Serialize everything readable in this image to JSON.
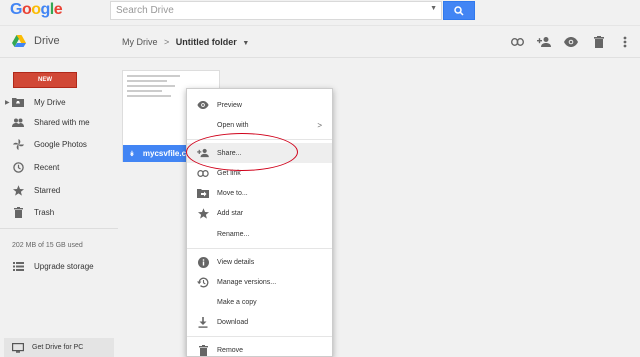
{
  "logo": {
    "letters": [
      "G",
      "o",
      "o",
      "g",
      "l",
      "e"
    ],
    "colors": [
      "#4285f4",
      "#ea4335",
      "#fbbc05",
      "#4285f4",
      "#34a853",
      "#ea4335"
    ]
  },
  "search": {
    "placeholder": "Search Drive"
  },
  "app": {
    "title": "Drive"
  },
  "breadcrumb": {
    "root": "My Drive",
    "separator": ">",
    "current": "Untitled folder"
  },
  "sidebar": {
    "new_label": "NEW",
    "items": [
      {
        "label": "My Drive",
        "icon": "my-drive-icon"
      },
      {
        "label": "Shared with me",
        "icon": "people-icon"
      },
      {
        "label": "Google Photos",
        "icon": "photos-pinwheel-icon"
      },
      {
        "label": "Recent",
        "icon": "clock-icon"
      },
      {
        "label": "Starred",
        "icon": "star-icon"
      },
      {
        "label": "Trash",
        "icon": "trash-icon"
      }
    ],
    "quota": "202 MB of 15 GB used",
    "upgrade": "Upgrade storage",
    "get_drive": "Get Drive for PC"
  },
  "file": {
    "name": "mycsvfile.c"
  },
  "menu": {
    "items": [
      {
        "label": "Preview",
        "icon": "eye-icon"
      },
      {
        "label": "Open with",
        "icon": "",
        "submenu": ">"
      },
      {
        "label": "Share...",
        "icon": "person-add-icon"
      },
      {
        "label": "Get link",
        "icon": "link-icon"
      },
      {
        "label": "Move to...",
        "icon": "folder-move-icon"
      },
      {
        "label": "Add star",
        "icon": "star-icon"
      },
      {
        "label": "Rename...",
        "icon": ""
      },
      {
        "label": "View details",
        "icon": "info-icon"
      },
      {
        "label": "Manage versions...",
        "icon": "history-icon"
      },
      {
        "label": "Make a copy",
        "icon": ""
      },
      {
        "label": "Download",
        "icon": "download-icon"
      },
      {
        "label": "Remove",
        "icon": "trash-icon"
      }
    ]
  },
  "colors": {
    "accent": "#4285f4",
    "new_button": "#d14836",
    "annotation": "#d0021b"
  }
}
